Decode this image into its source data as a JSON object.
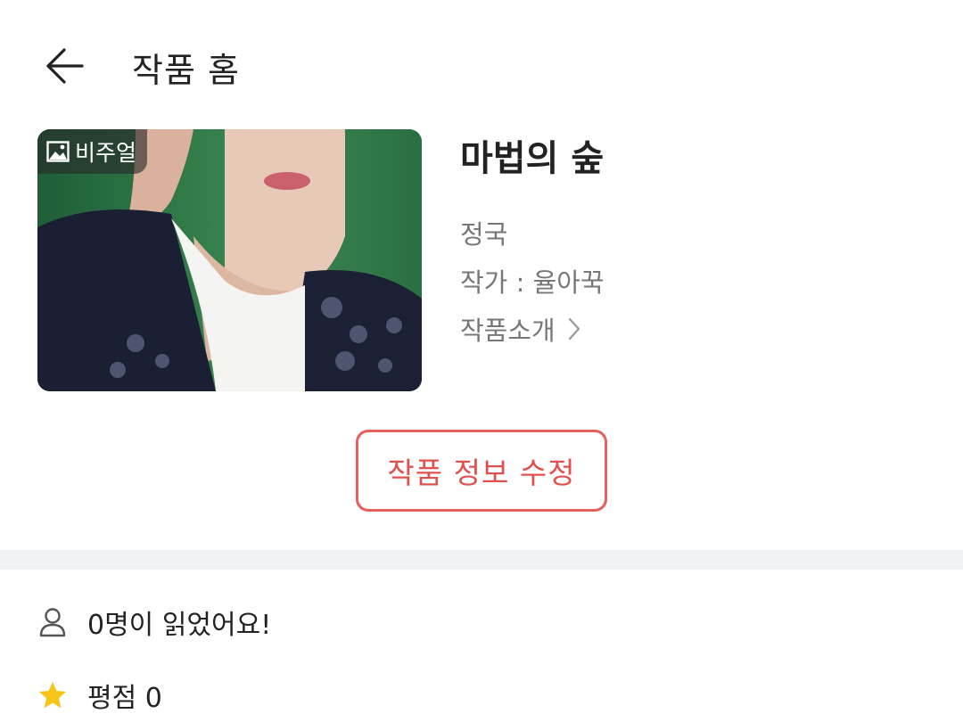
{
  "header": {
    "title": "작품 홈",
    "back_icon": "arrow-left-icon"
  },
  "work": {
    "cover_badge": "비주얼",
    "title": "마법의 숲",
    "genre": "정국",
    "author": "작가 : 율아꾹",
    "intro_link": "작품소개"
  },
  "actions": {
    "edit_label": "작품 정보 수정"
  },
  "stats": {
    "readers": "0명이 읽었어요!",
    "rating": "평점 0"
  },
  "colors": {
    "accent": "#e8605e",
    "star": "#f5c518",
    "divider": "#f1f2f4"
  }
}
